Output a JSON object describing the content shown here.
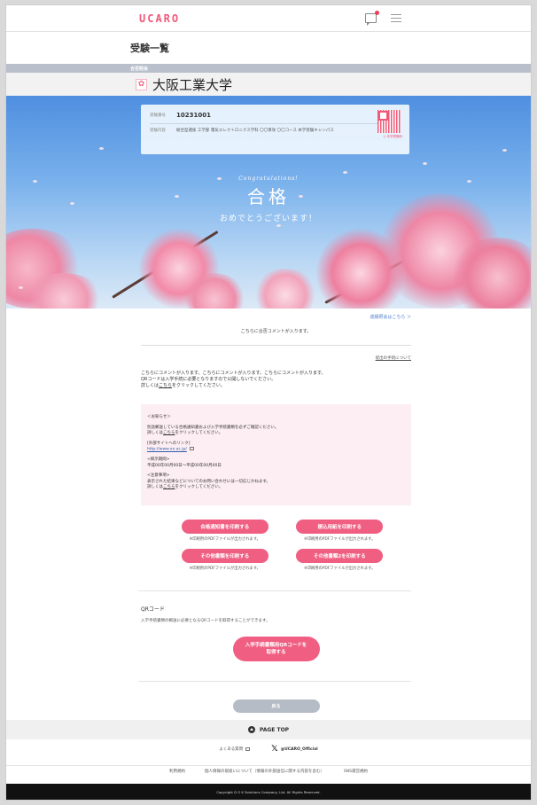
{
  "header": {
    "logo": "UCARO"
  },
  "page": {
    "title": "受験一覧",
    "status": "合否照会"
  },
  "university": {
    "name": "大阪工業大学"
  },
  "exam_card": {
    "number_label": "受験番号",
    "number": "10231001",
    "detail_label": "受験内容",
    "detail": "総合型選抜 工学部 電気エレクトロニクス学科 〇〇専攻 〇〇コース 本学受験キャンパス",
    "qr_caption": "◎ 本学受験時"
  },
  "hero": {
    "congrats": "Congratulations!",
    "result": "合格",
    "message": "おめでとうございます！"
  },
  "content": {
    "top_link": "成績照会はこちら ＞",
    "comment": "こちらに合否コメントが入ります。",
    "entry_link": "提出の手続について",
    "comment_lines": [
      "こちらにコメントが入ります。こちらにコメントが入ります。こちらにコメントが入ります。",
      "QRコードは入学手続に必要となりますので公開しないでください。"
    ],
    "detail_prefix": "詳しくは",
    "detail_link": "こちら",
    "detail_suffix": "をクリックしてください。"
  },
  "notice": {
    "heading": "＜お知らせ＞",
    "line1": "別途郵送している合格通知書および入学手続書類を必ずご確認ください。",
    "line2_prefix": "詳しくは",
    "line2_link": "こちら",
    "line2_suffix": "をクリックしてください。",
    "external_label": "[外部サイトへのリンク]",
    "external_url": "http://www.xx.ac.jp/",
    "period_label": "<掲示期間>",
    "period": "平成00年00月00日～平成00年00月00日",
    "caution_label": "<注意事項>",
    "caution": "表示された結果などについてのお問い合わせには一切応じかねます。",
    "caution_prefix": "詳しくは",
    "caution_link": "こちら",
    "caution_suffix": "をクリックしてください。"
  },
  "buttons": {
    "print_pass": "合格通知書を印刷する",
    "print_payment": "振込用紙を印刷する",
    "print_other": "その他書類を印刷する",
    "print_other2": "その他書類2を印刷する",
    "note": "※印刷用のPDFファイルが出力されます。"
  },
  "qr_section": {
    "title": "QRコード",
    "description": "入学手続書類の郵送に必要となるQRコードを取得することができます。",
    "button": "入学手続書類用QRコードを取得する"
  },
  "back_button": "戻る",
  "pagetop": "PAGE TOP",
  "footer": {
    "faq": "よくある質問",
    "sns": "@UCARO_Official",
    "terms": "利用規約",
    "privacy": "個人情報の取扱いについて（情報の外部送信に関する内容を含む）",
    "sns_policy": "SNS運営規約",
    "copyright": "Copyright D O K Solutions Company, Ltd. All Rights Reserved."
  },
  "colors": {
    "accent": "#f05f82",
    "sky": "#79b1ec"
  }
}
